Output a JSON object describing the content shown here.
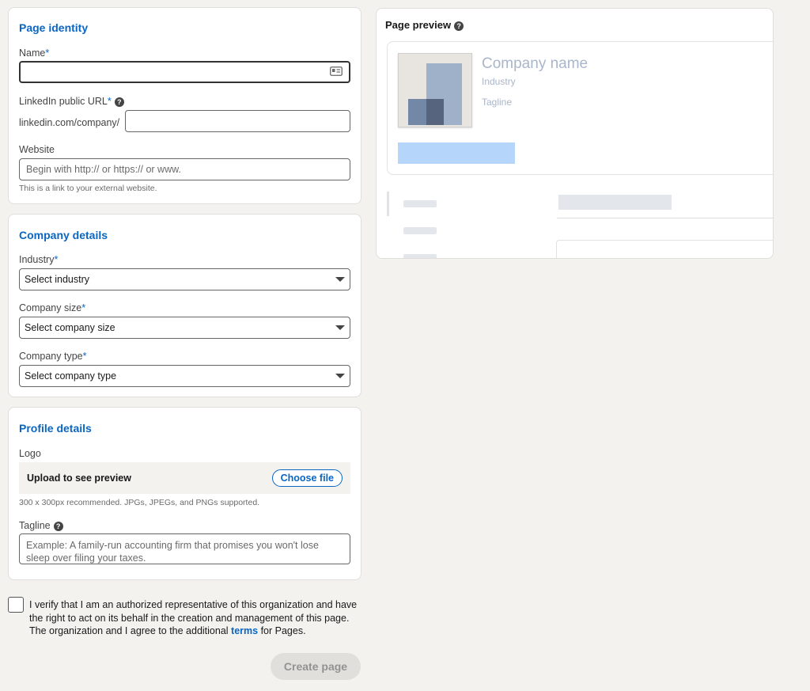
{
  "identity": {
    "title": "Page identity",
    "name_label": "Name",
    "required_mark": "*",
    "name_value": "",
    "url_label": "LinkedIn public URL",
    "url_prefix": "linkedin.com/company/",
    "url_value": "",
    "website_label": "Website",
    "website_placeholder": "Begin with http:// or https:// or www.",
    "website_hint": "This is a link to your external website."
  },
  "company": {
    "title": "Company details",
    "industry_label": "Industry",
    "industry_value": "Select industry",
    "size_label": "Company size",
    "size_value": "Select company size",
    "type_label": "Company type",
    "type_value": "Select company type"
  },
  "profile": {
    "title": "Profile details",
    "logo_label": "Logo",
    "upload_text": "Upload to see preview",
    "choose_file": "Choose file",
    "logo_hint": "300 x 300px recommended. JPGs, JPEGs, and PNGs supported.",
    "tagline_label": "Tagline",
    "tagline_placeholder": "Example: A family-run accounting firm that promises you won't lose sleep over filing your taxes."
  },
  "verify": {
    "text_before": "I verify that I am an authorized representative of this organization and have the right to act on its behalf in the creation and management of this page. The organization and I agree to the additional ",
    "link": "terms",
    "text_after": " for Pages."
  },
  "create_button": "Create page",
  "preview": {
    "title": "Page preview",
    "company_name": "Company name",
    "industry": "Industry",
    "tagline": "Tagline"
  },
  "colors": {
    "accent": "#0a66c2",
    "background": "#f3f2ef",
    "preview_button": "#b5d5fb",
    "logo_light": "#9fb0c9",
    "logo_dark": "#56657d"
  },
  "icons": {
    "help": "question-circle-icon",
    "contact_card": "contact-card-icon",
    "dropdown": "caret-down-icon"
  }
}
